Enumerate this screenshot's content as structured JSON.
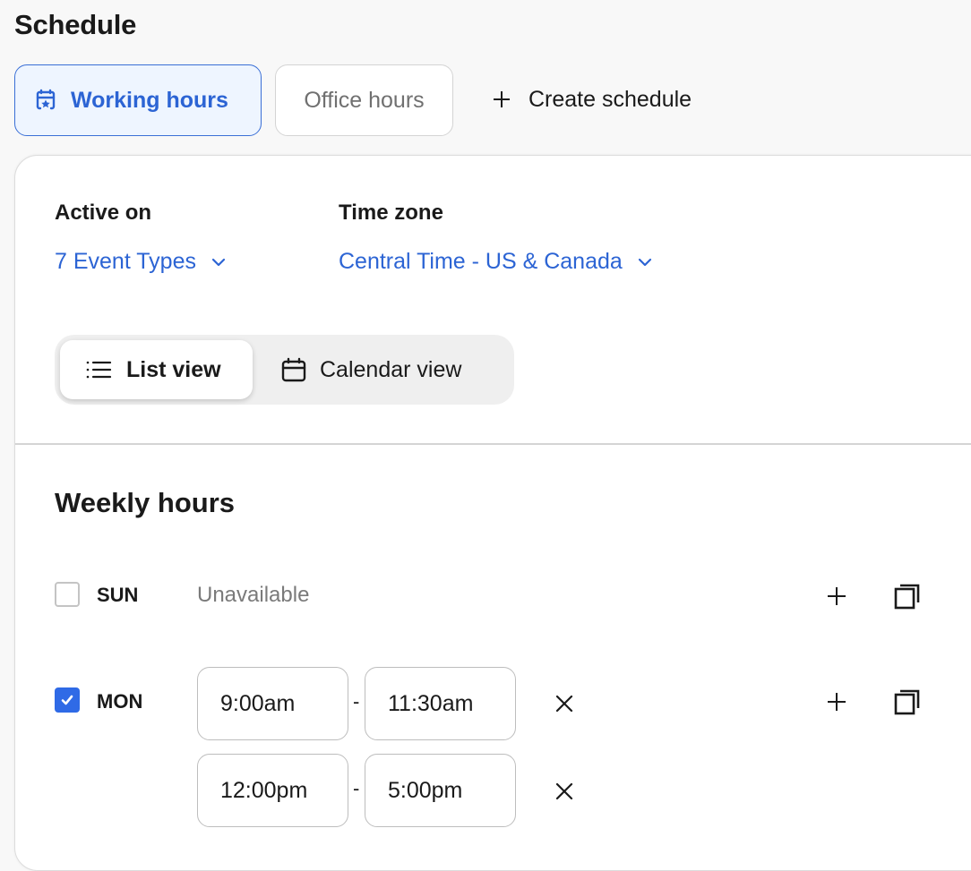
{
  "header": {
    "title": "Schedule"
  },
  "tabs": [
    {
      "label": "Working hours",
      "icon": "calendar-star-icon",
      "active": true
    },
    {
      "label": "Office hours",
      "active": false
    }
  ],
  "create_schedule": {
    "label": "Create schedule",
    "icon": "plus-icon"
  },
  "settings": {
    "active_on": {
      "label": "Active on",
      "value": "7 Event Types"
    },
    "time_zone": {
      "label": "Time zone",
      "value": "Central Time - US & Canada"
    }
  },
  "view_toggle": {
    "options": [
      {
        "label": "List view",
        "icon": "list-icon",
        "selected": true
      },
      {
        "label": "Calendar view",
        "icon": "calendar-icon",
        "selected": false
      }
    ]
  },
  "weekly_hours": {
    "title": "Weekly hours",
    "separator": "-",
    "days": [
      {
        "day": "SUN",
        "checked": false,
        "status": "Unavailable",
        "intervals": []
      },
      {
        "day": "MON",
        "checked": true,
        "intervals": [
          {
            "start": "9:00am",
            "end": "11:30am"
          },
          {
            "start": "12:00pm",
            "end": "5:00pm"
          }
        ]
      }
    ]
  },
  "colors": {
    "accent": "#2c64d4",
    "checkbox_checked": "#2f6ae6",
    "active_tab_bg": "#eef5ff"
  }
}
